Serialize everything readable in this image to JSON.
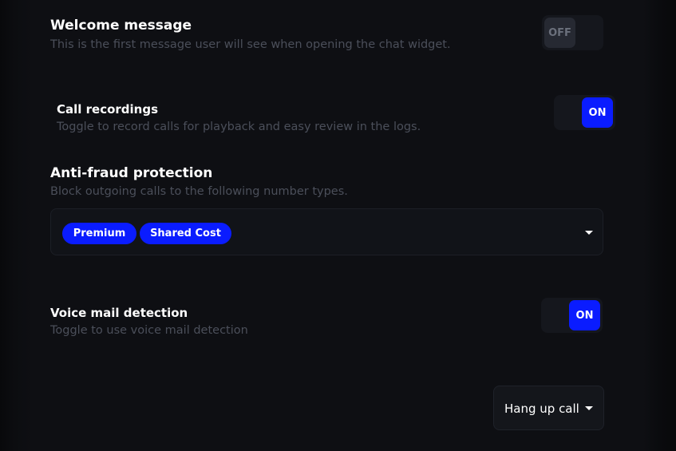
{
  "welcome": {
    "title": "Welcome message",
    "description": "This is the first message user will see when opening the chat widget.",
    "toggle_label": "OFF",
    "toggle_state": "off"
  },
  "call_recordings": {
    "title": "Call recordings",
    "description": "Toggle to record calls for playback and easy review in the logs.",
    "toggle_label": "ON",
    "toggle_state": "on"
  },
  "anti_fraud": {
    "title": "Anti-fraud protection",
    "description": "Block outgoing calls to the following number types.",
    "tags": [
      "Premium",
      "Shared Cost"
    ]
  },
  "voicemail": {
    "title": "Voice mail detection",
    "description": "Toggle to use voice mail detection",
    "toggle_label": "ON",
    "toggle_state": "on"
  },
  "voicemail_action": {
    "selected": "Hang up call"
  },
  "colors": {
    "accent": "#0a1cff",
    "background": "#0e0f13",
    "muted_text": "#4b4f5a"
  },
  "icons": {
    "dropdown": "caret-down-icon"
  }
}
